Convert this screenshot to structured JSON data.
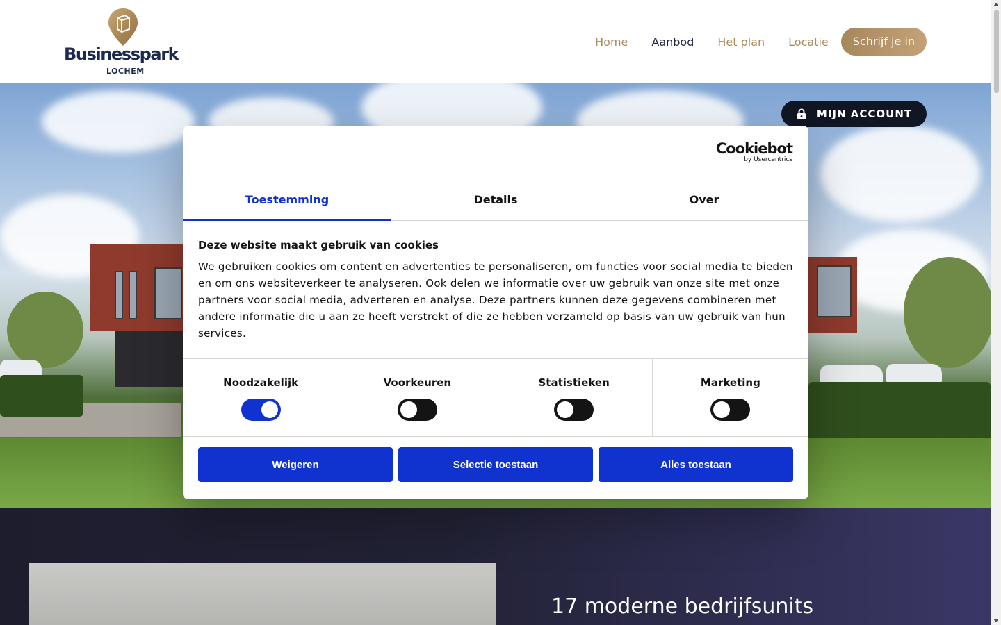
{
  "header": {
    "logo": {
      "name": "Businesspark",
      "sub": "LOCHEM"
    },
    "nav": [
      {
        "label": "Home",
        "active": false
      },
      {
        "label": "Aanbod",
        "active": true
      },
      {
        "label": "Het plan",
        "active": false
      },
      {
        "label": "Locatie",
        "active": false
      }
    ],
    "cta_label": "Schrijf je in"
  },
  "hero": {
    "account_label": "MIJN ACCOUNT",
    "account_icon": "lock-icon"
  },
  "section": {
    "title": "17 moderne bedrijfsunits"
  },
  "cookie_dialog": {
    "brand": {
      "name": "Cookiebot",
      "by": "by Usercentrics"
    },
    "tabs": [
      {
        "label": "Toestemming",
        "active": true
      },
      {
        "label": "Details",
        "active": false
      },
      {
        "label": "Over",
        "active": false
      }
    ],
    "title": "Deze website maakt gebruik van cookies",
    "text": "We gebruiken cookies om content en advertenties te personaliseren, om functies voor social media te bieden en om ons websiteverkeer te analyseren. Ook delen we informatie over uw gebruik van onze site met onze partners voor social media, adverteren en analyse. Deze partners kunnen deze gegevens combineren met andere informatie die u aan ze heeft verstrekt of die ze hebben verzameld op basis van uw gebruik van hun services.",
    "toggles": [
      {
        "label": "Noodzakelijk",
        "on": true
      },
      {
        "label": "Voorkeuren",
        "on": false
      },
      {
        "label": "Statistieken",
        "on": false
      },
      {
        "label": "Marketing",
        "on": false
      }
    ],
    "buttons": {
      "reject": "Weigeren",
      "selection": "Selectie toestaan",
      "all": "Alles toestaan"
    }
  },
  "colors": {
    "accent_gold": "#a98a5c",
    "navy": "#1d2a4f",
    "cookiebot_blue": "#1032cf"
  }
}
